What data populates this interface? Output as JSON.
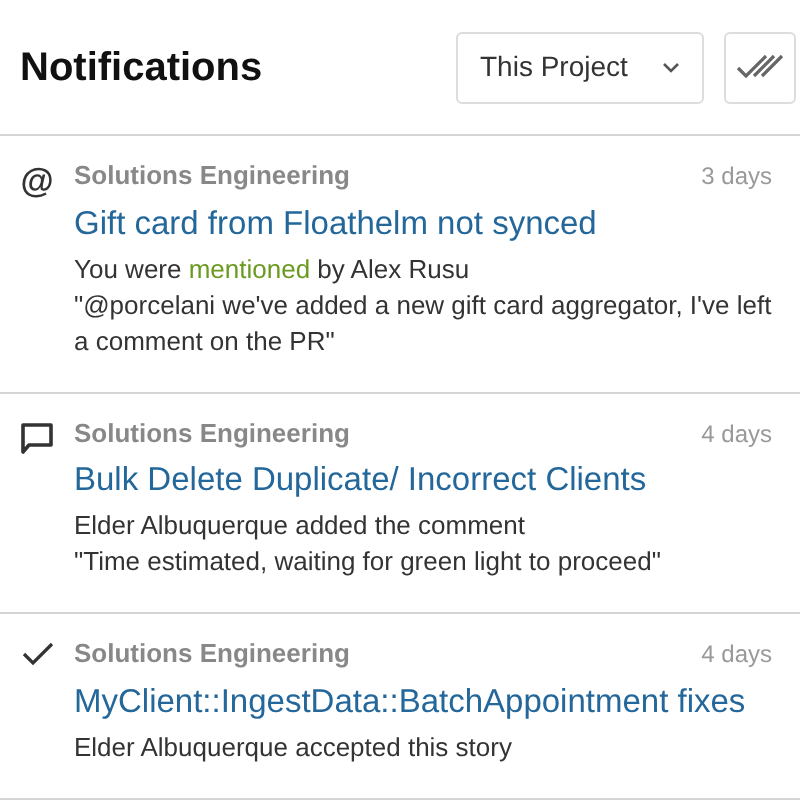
{
  "header": {
    "title": "Notifications",
    "scope": {
      "value": "This Project"
    },
    "mark_all_read": {
      "kind": "button"
    }
  },
  "notifications": [
    {
      "kind": "mention",
      "icon_text": "@",
      "project": "Solutions Engineering",
      "time": "3 days",
      "title": "Gift card from Floathelm not synced",
      "lines": [
        [
          {
            "text": "You were ",
            "highlight": false
          },
          {
            "text": "mentioned",
            "highlight": true
          },
          {
            "text": " by Alex Rusu",
            "highlight": false
          }
        ],
        [
          {
            "text": "\"@porcelani we've added a new gift card aggregator, I've left a comment on the PR\"",
            "highlight": false
          }
        ]
      ]
    },
    {
      "kind": "comment",
      "project": "Solutions Engineering",
      "time": "4 days",
      "title": "Bulk Delete Duplicate/ Incorrect Clients",
      "lines": [
        [
          {
            "text": "Elder Albuquerque added the comment",
            "highlight": false
          }
        ],
        [
          {
            "text": "\"Time estimated, waiting for green light to proceed\"",
            "highlight": false
          }
        ]
      ]
    },
    {
      "kind": "accepted",
      "project": "Solutions Engineering",
      "time": "4 days",
      "title": "MyClient::IngestData::BatchAppointment fixes",
      "lines": [
        [
          {
            "text": "Elder Albuquerque accepted this story",
            "highlight": false
          }
        ]
      ]
    }
  ]
}
